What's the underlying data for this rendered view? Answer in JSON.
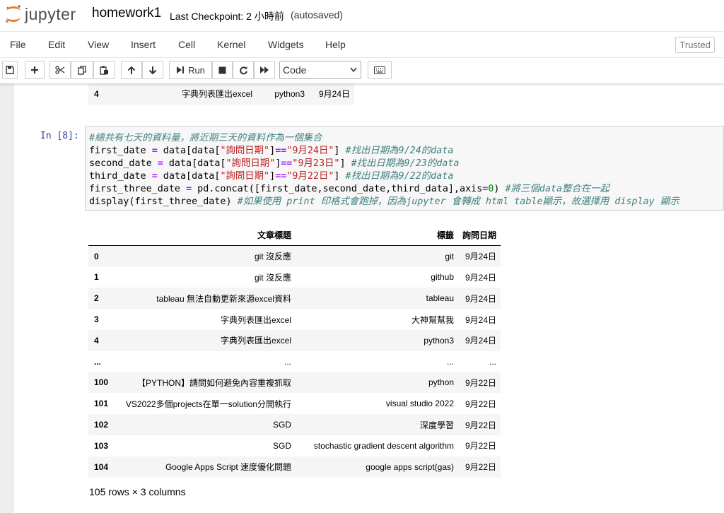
{
  "header": {
    "logo_text": "jupyter",
    "notebook_name": "homework1",
    "checkpoint": "Last Checkpoint: 2 小時前",
    "autosave": "(autosaved)"
  },
  "menu": {
    "items": [
      "File",
      "Edit",
      "View",
      "Insert",
      "Cell",
      "Kernel",
      "Widgets",
      "Help"
    ],
    "trusted": "Trusted"
  },
  "toolbar": {
    "run_label": "Run",
    "cell_type": "Code"
  },
  "prev_output": {
    "rows": [
      {
        "idx": "4",
        "title": "字典列表匯出excel",
        "tag": "python3",
        "date": "9月24日"
      }
    ]
  },
  "cell": {
    "prompt": "In [8]:",
    "lines": [
      "#總共有七天的資料量，將近期三天的資料作為一個集合",
      "first_date = data[data[\"詢問日期\"]==\"9月24日\"] #找出日期為9/24的data",
      "second_date = data[data[\"詢問日期\"]==\"9月23日\"] #找出日期為9/23的data",
      "third_date = data[data[\"詢問日期\"]==\"9月22日\"] #找出日期為9/22的data",
      "first_three_date = pd.concat([first_date,second_date,third_data],axis=0) #將三個data整合在一起",
      "display(first_three_date) #如果使用 print 印格式會跑掉，因為jupyter 會轉成 html table顯示，故選擇用 display 顯示"
    ]
  },
  "output": {
    "columns": [
      "文章標題",
      "標籤",
      "詢問日期"
    ],
    "rows": [
      {
        "idx": "0",
        "title": "git 沒反應",
        "tag": "git",
        "date": "9月24日"
      },
      {
        "idx": "1",
        "title": "git 沒反應",
        "tag": "github",
        "date": "9月24日"
      },
      {
        "idx": "2",
        "title": "tableau 無法自動更新來源excel資料",
        "tag": "tableau",
        "date": "9月24日"
      },
      {
        "idx": "3",
        "title": "字典列表匯出excel",
        "tag": "大神幫幫我",
        "date": "9月24日"
      },
      {
        "idx": "4",
        "title": "字典列表匯出excel",
        "tag": "python3",
        "date": "9月24日"
      },
      {
        "idx": "...",
        "title": "...",
        "tag": "...",
        "date": "..."
      },
      {
        "idx": "100",
        "title": "【PYTHON】請問如何避免內容重複抓取",
        "tag": "python",
        "date": "9月22日"
      },
      {
        "idx": "101",
        "title": "VS2022多個projects在單一solution分開執行",
        "tag": "visual studio 2022",
        "date": "9月22日"
      },
      {
        "idx": "102",
        "title": "SGD",
        "tag": "深度學習",
        "date": "9月22日"
      },
      {
        "idx": "103",
        "title": "SGD",
        "tag": "stochastic gradient descent algorithm",
        "date": "9月22日"
      },
      {
        "idx": "104",
        "title": "Google Apps Script 速度優化問題",
        "tag": "google apps script(gas)",
        "date": "9月22日"
      }
    ],
    "shape": "105 rows × 3 columns"
  }
}
